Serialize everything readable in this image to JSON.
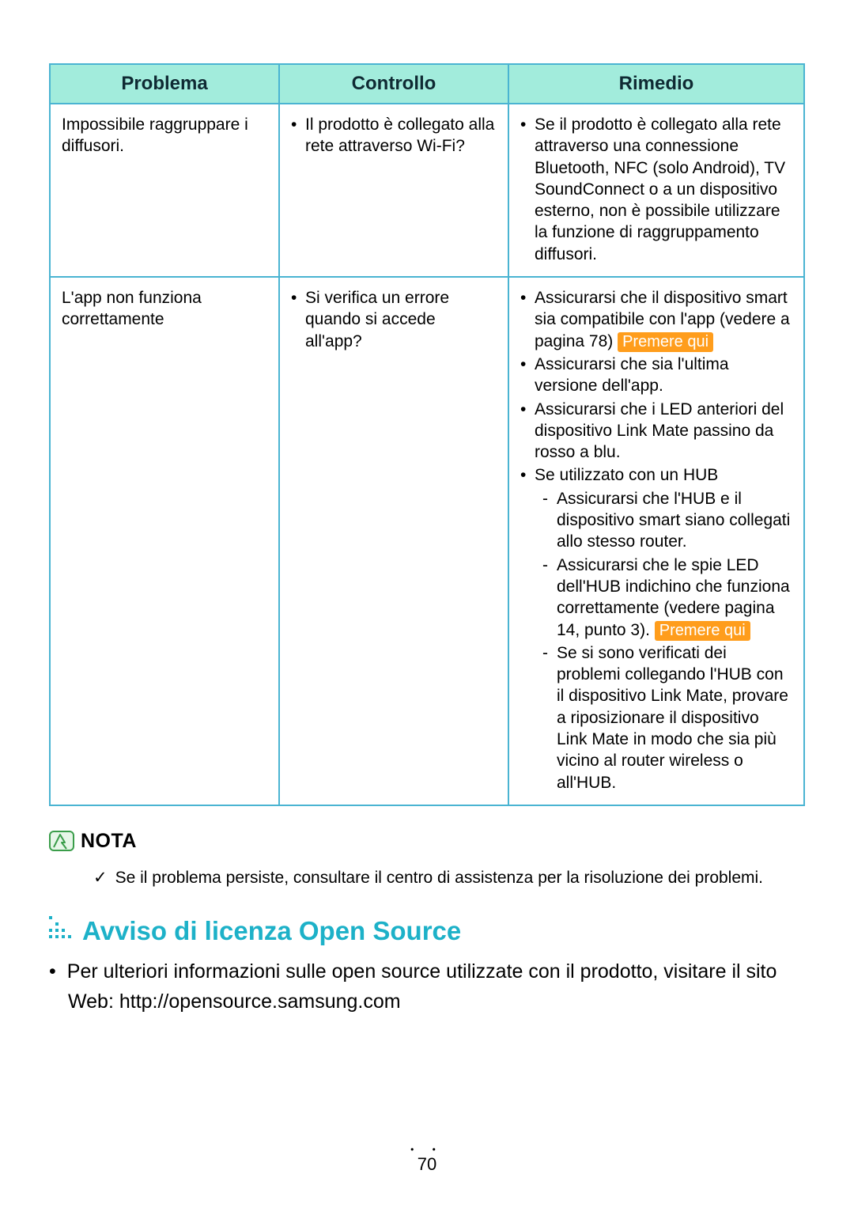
{
  "table": {
    "headers": {
      "problem": "Problema",
      "control": "Controllo",
      "remedy": "Rimedio"
    },
    "rows": [
      {
        "problem": "Impossibile raggruppare i diffusori.",
        "control_items": [
          "Il prodotto è collegato alla rete attraverso Wi-Fi?"
        ],
        "remedy_items": [
          "Se il prodotto è collegato alla rete attraverso una connessione Bluetooth, NFC (solo Android), TV SoundConnect o a un dispositivo esterno, non è possibile utilizzare la funzione di raggruppamento diffusori."
        ]
      },
      {
        "problem": "L'app non funziona correttamente",
        "control_items": [
          "Si verifica un errore quando si accede all'app?"
        ],
        "remedy_items": [
          {
            "pre": "Assicurarsi che il dispositivo smart sia compatibile con l'app (vedere a pagina 78) ",
            "link": "Premere qui"
          },
          "Assicurarsi che sia l'ultima versione dell'app.",
          "Assicurarsi che i LED anteriori del dispositivo Link Mate passino da rosso a blu.",
          {
            "text": "Se utilizzato con un HUB",
            "sub": [
              "Assicurarsi che l'HUB e il dispositivo smart siano collegati allo stesso router.",
              {
                "pre": "Assicurarsi che le spie LED dell'HUB indichino che funziona correttamente (vedere pagina 14, punto 3). ",
                "link": "Premere qui"
              },
              "Se si sono verificati dei problemi collegando l'HUB con il dispositivo Link Mate, provare a riposizionare il dispositivo Link Mate in modo che sia più vicino al router wireless o all'HUB."
            ]
          }
        ]
      }
    ]
  },
  "premere_label": "Premere qui",
  "nota_label": "NOTA",
  "nota_text": "Se il problema persiste, consultare il centro di assistenza per la risoluzione dei problemi.",
  "section_heading": "Avviso di licenza Open Source",
  "body_para": "Per ulteriori informazioni sulle open source utilizzate con il prodotto, visitare il sito Web: http://opensource.samsung.com",
  "page_number": "70"
}
